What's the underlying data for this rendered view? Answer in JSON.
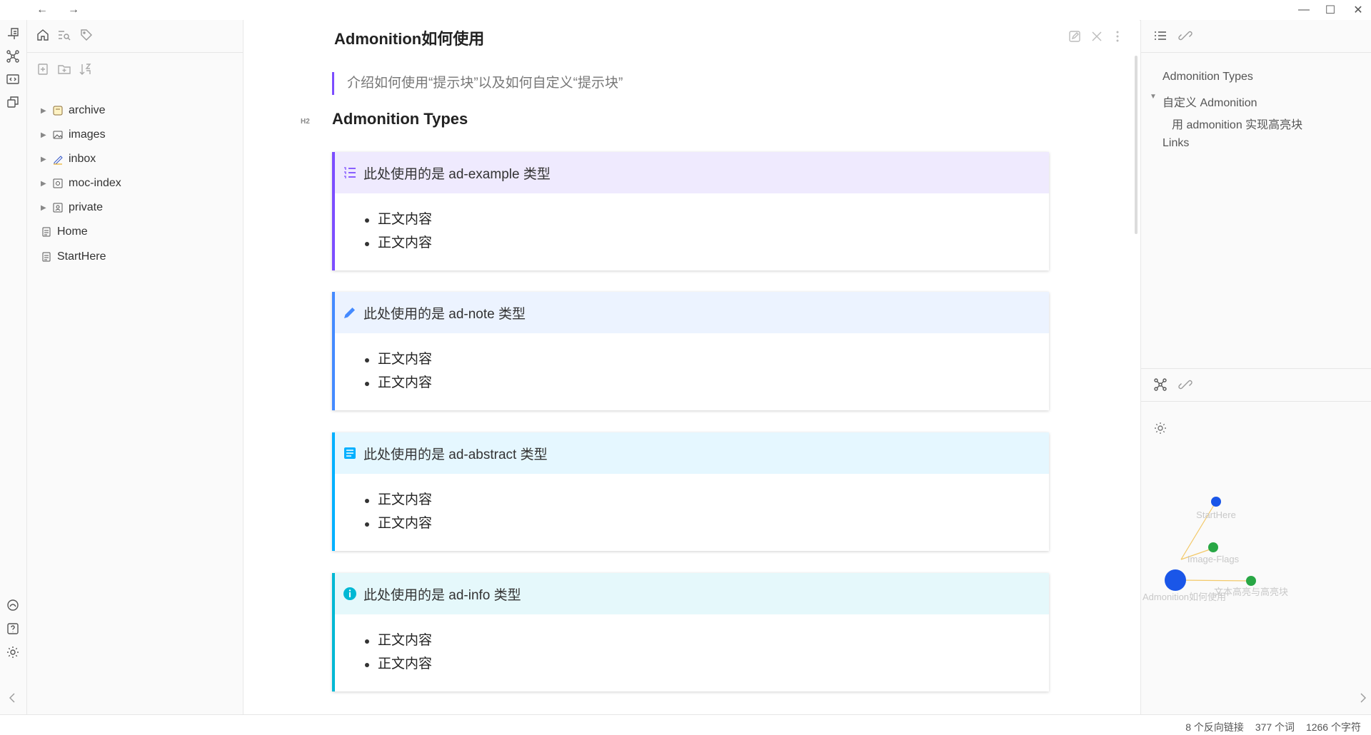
{
  "nav": {
    "back": "←",
    "forward": "→"
  },
  "window": {
    "minimize": "—",
    "maximize": "☐",
    "close": "✕"
  },
  "left_sidebar": {
    "tree": [
      {
        "label": "archive",
        "type": "folder",
        "icon": "archive-folder-icon"
      },
      {
        "label": "images",
        "type": "folder",
        "icon": "image-folder-icon"
      },
      {
        "label": "inbox",
        "type": "folder",
        "icon": "inbox-folder-icon"
      },
      {
        "label": "moc-index",
        "type": "folder",
        "icon": "index-folder-icon"
      },
      {
        "label": "private",
        "type": "folder",
        "icon": "private-folder-icon"
      },
      {
        "label": "Home",
        "type": "file",
        "icon": "note-file-icon"
      },
      {
        "label": "StartHere",
        "type": "file",
        "icon": "note-file-icon"
      }
    ]
  },
  "note": {
    "title": "Admonition如何使用",
    "quote": "介绍如何使用“提示块”以及如何自定义“提示块”",
    "h2_badge": "H2",
    "h2": "Admonition Types",
    "admonitions": [
      {
        "title": "此处使用的是 ad-example 类型",
        "items": [
          "正文内容",
          "正文内容"
        ],
        "accent": "#7c4dff",
        "bg": "#efeafe",
        "icon": "list-icon"
      },
      {
        "title": "此处使用的是 ad-note 类型",
        "items": [
          "正文内容",
          "正文内容"
        ],
        "accent": "#448aff",
        "bg": "#ecf3ff",
        "icon": "pencil-icon"
      },
      {
        "title": "此处使用的是 ad-abstract 类型",
        "items": [
          "正文内容",
          "正文内容"
        ],
        "accent": "#00b0ff",
        "bg": "#e5f7ff",
        "icon": "book-icon"
      },
      {
        "title": "此处使用的是 ad-info 类型",
        "items": [
          "正文内容",
          "正文内容"
        ],
        "accent": "#00b8d4",
        "bg": "#e5f8fb",
        "icon": "info-icon"
      }
    ]
  },
  "outline": {
    "items": [
      {
        "label": "Admonition Types",
        "level": 1
      },
      {
        "label": "自定义 Admonition",
        "level": 1,
        "collapsible": true
      },
      {
        "label": "用 admonition 实现高亮块",
        "level": 2
      },
      {
        "label": "Links",
        "level": 1
      }
    ]
  },
  "graph": {
    "nodes": [
      {
        "label": "StartHere",
        "color": "#1a56e8"
      },
      {
        "label": "Image-Flags",
        "color": "#28a745"
      },
      {
        "label": "文本高亮与高亮块",
        "color": "#28a745"
      },
      {
        "label": "Admonition如何使用",
        "color": "#1a56e8"
      }
    ]
  },
  "status": {
    "backlinks": "8 个反向链接",
    "words": "377 个词",
    "chars": "1266 个字符"
  },
  "colors": {
    "accent": "#7c4dff",
    "link_line": "#f3c969"
  }
}
